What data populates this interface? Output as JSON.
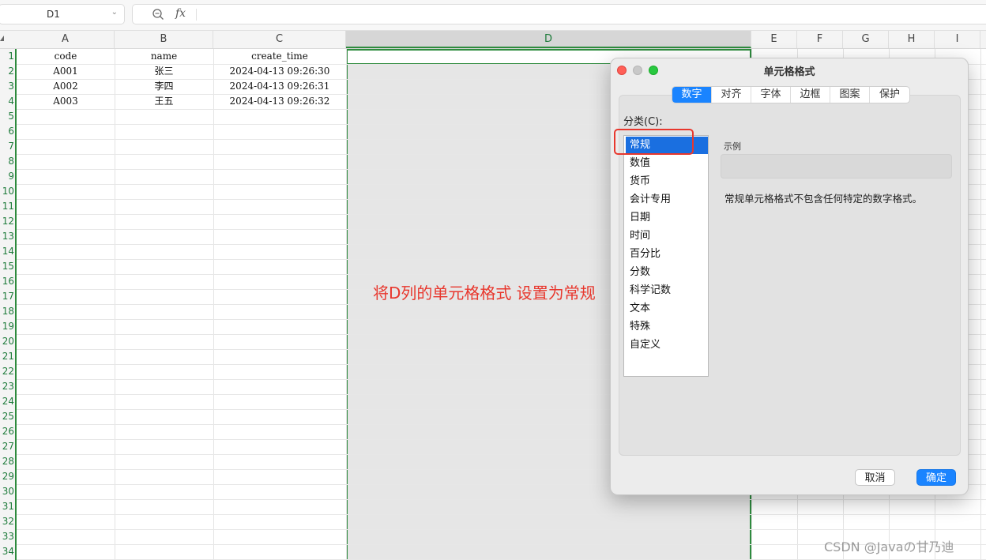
{
  "formula_bar": {
    "name_box": "D1",
    "formula": ""
  },
  "columns": [
    "A",
    "B",
    "C",
    "D",
    "E",
    "F",
    "G",
    "H",
    "I"
  ],
  "selected_column": "D",
  "row_numbers": [
    "1",
    "2",
    "3",
    "4",
    "5",
    "6",
    "7",
    "8",
    "9",
    "10",
    "11",
    "12",
    "13",
    "14",
    "15",
    "16",
    "17",
    "18",
    "19",
    "20",
    "21",
    "22",
    "23",
    "24",
    "25",
    "26",
    "27",
    "28",
    "29",
    "30",
    "31",
    "32",
    "33",
    "34"
  ],
  "table": {
    "headers": [
      "code",
      "name",
      "create_time"
    ],
    "rows": [
      [
        "A001",
        "张三",
        "2024-04-13 09:26:30"
      ],
      [
        "A002",
        "李四",
        "2024-04-13 09:26:31"
      ],
      [
        "A003",
        "王五",
        "2024-04-13 09:26:32"
      ]
    ]
  },
  "annotation": "将D列的单元格格式 设置为常规",
  "dialog": {
    "title": "单元格格式",
    "tabs": [
      "数字",
      "对齐",
      "字体",
      "边框",
      "图案",
      "保护"
    ],
    "active_tab": "数字",
    "category_label": "分类(C):",
    "categories": [
      "常规",
      "数值",
      "货币",
      "会计专用",
      "日期",
      "时间",
      "百分比",
      "分数",
      "科学记数",
      "文本",
      "特殊",
      "自定义"
    ],
    "selected_category": "常规",
    "sample_label": "示例",
    "sample_value": "",
    "description": "常规单元格格式不包含任何特定的数字格式。",
    "cancel_label": "取消",
    "ok_label": "确定"
  },
  "colors": {
    "accent": "#1a84ff",
    "selection_border": "#2e8b3e",
    "annotation": "#e8372d"
  },
  "watermark": "CSDN @Javaの甘乃迪"
}
